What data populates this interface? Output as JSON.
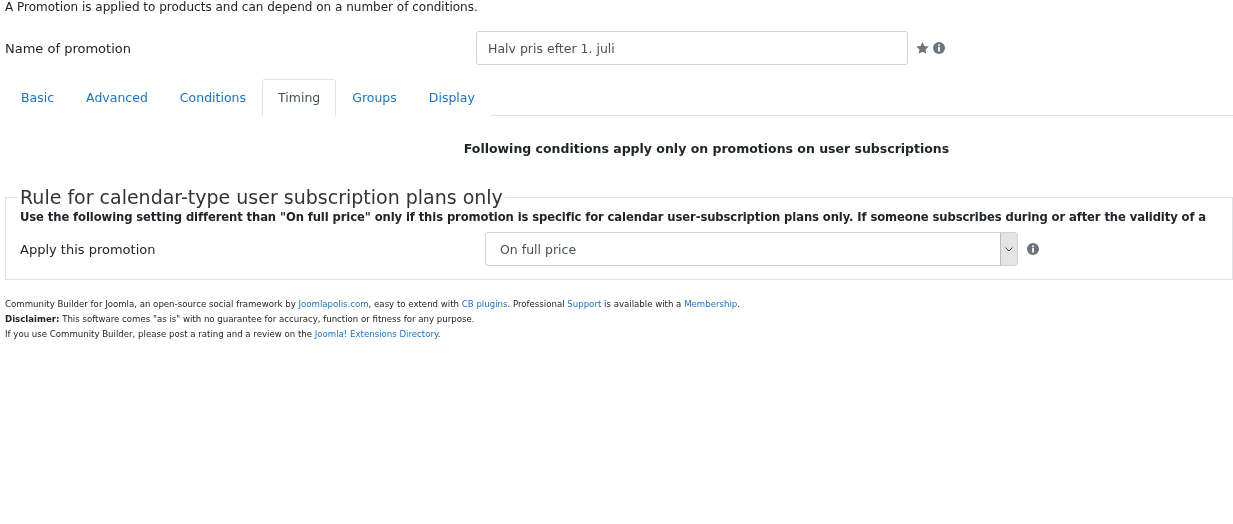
{
  "intro": "A Promotion is applied to products and can depend on a number of conditions.",
  "name_field": {
    "label": "Name of promotion",
    "value": "Halv pris efter 1. juli",
    "required": true,
    "has_info": true
  },
  "tabs": [
    {
      "label": "Basic",
      "selected": false
    },
    {
      "label": "Advanced",
      "selected": false
    },
    {
      "label": "Conditions",
      "selected": false
    },
    {
      "label": "Timing",
      "selected": true
    },
    {
      "label": "Groups",
      "selected": false
    },
    {
      "label": "Display",
      "selected": false
    }
  ],
  "tab_heading": "Following conditions apply only on promotions on user subscriptions",
  "fieldset": {
    "legend": "Rule for calendar-type user subscription plans only",
    "description": "Use the following setting different than \"On full price\" only if this promotion is specific for calendar user-subscription plans only. If someone subscribes during or after the validity of a",
    "field": {
      "label": "Apply this promotion",
      "value": "On full price",
      "has_info": true
    }
  },
  "footer": [
    [
      {
        "kind": "text",
        "text": "Community Builder for Joomla, an open-source social framework by"
      },
      {
        "kind": "link",
        "text": "Joomlapolis.com"
      },
      {
        "kind": "text",
        "text": ", easy to extend with"
      },
      {
        "kind": "link",
        "text": "CB plugins"
      },
      {
        "kind": "text",
        "text": ". Professional"
      },
      {
        "kind": "link",
        "text": "Support"
      },
      {
        "kind": "text",
        "text": "is available with a"
      },
      {
        "kind": "link",
        "text": "Membership"
      },
      {
        "kind": "text",
        "text": "."
      }
    ],
    [
      {
        "kind": "text",
        "text": "**Disclaimer:** This software comes \"as is\" with no guarantee for accuracy, function or fitness for any purpose."
      }
    ],
    [
      {
        "kind": "text",
        "text": "If you use Community Builder, please post a rating and a review on the"
      },
      {
        "kind": "link",
        "text": "Joomla! Extensions Directory"
      },
      {
        "kind": "text",
        "text": "."
      }
    ]
  ]
}
